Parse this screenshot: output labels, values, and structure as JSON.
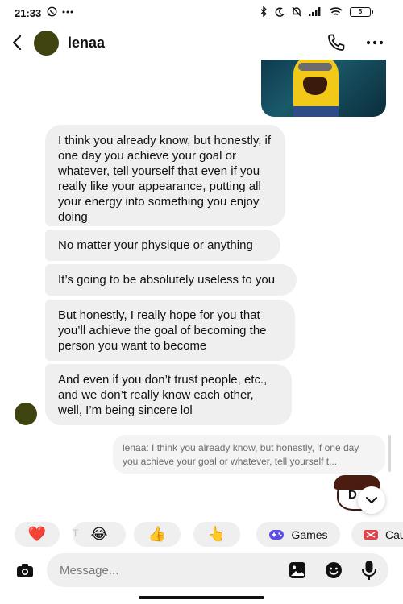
{
  "status_bar": {
    "time": "21:33",
    "battery_level": "5"
  },
  "header": {
    "contact_name": "lenaa",
    "avatar_color": "#3e430f"
  },
  "messages": [
    {
      "text": "I think you already know, but honestly, if one day you achieve your goal or whatever, tell yourself that even if you really like your appearance, putting all your energy into something you enjoy doing"
    },
    {
      "text": "No matter your physique or anything"
    },
    {
      "text": "It’s going to be absolutely useless to you"
    },
    {
      "text": "But honestly, I really hope for you that you’ll achieve the goal of becoming the person you want to become"
    },
    {
      "text": "And even if you don’t trust people, etc., and we don’t really know each other, well, I’m being sincere lol"
    }
  ],
  "reply_preview": {
    "text": "lenaa: I think you already know, but honestly, if one day you achieve your goal or whatever, tell yourself t..."
  },
  "sticker": {
    "letter": "D"
  },
  "quick_reactions": {
    "heart": "❤️",
    "faded_letter": "T",
    "laugh": "😂",
    "thumbs_up": "👍",
    "point": "👆",
    "games_label": "Games",
    "cut_label": "Cau"
  },
  "composer": {
    "placeholder": "Message..."
  },
  "colors": {
    "bubble_bg": "#efefef",
    "games_icon": "#5b4ee6",
    "ca_icon": "#e0434b"
  }
}
